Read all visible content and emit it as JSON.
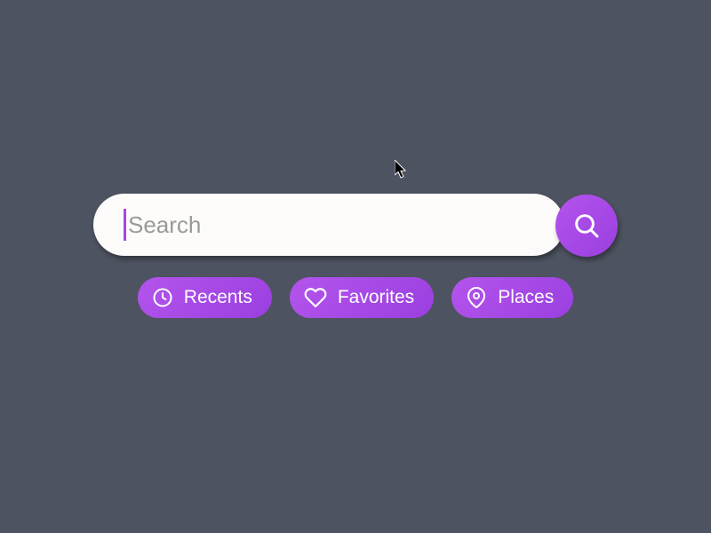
{
  "search": {
    "placeholder": "Search",
    "value": ""
  },
  "chips": [
    {
      "label": "Recents",
      "icon": "clock-icon"
    },
    {
      "label": "Favorites",
      "icon": "heart-icon"
    },
    {
      "label": "Places",
      "icon": "pin-icon"
    }
  ],
  "colors": {
    "background": "#4d5360",
    "accent": "#a845e6",
    "chip_gradient_start": "#b454ec",
    "chip_gradient_end": "#9a3fe0",
    "search_bg": "#fdfcfb",
    "placeholder": "#9a9a98"
  }
}
